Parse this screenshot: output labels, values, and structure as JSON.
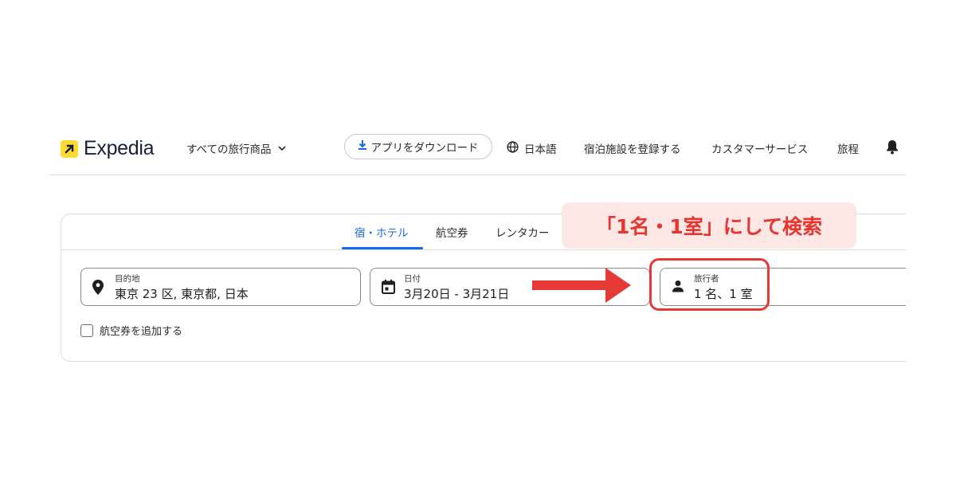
{
  "header": {
    "logo_text": "Expedia",
    "all_products": "すべての旅行商品",
    "app_download": "アプリをダウンロード",
    "language": "日本語",
    "list_property": "宿泊施設を登録する",
    "customer_service": "カスタマーサービス",
    "trips": "旅程",
    "icons": [
      "expedia-logo-icon",
      "chevron-down-icon",
      "download-icon",
      "globe-icon",
      "bell-icon"
    ]
  },
  "search": {
    "tabs": [
      {
        "label": "宿・ホテル",
        "active": true
      },
      {
        "label": "航空券",
        "active": false
      },
      {
        "label": "レンタカー",
        "active": false
      }
    ],
    "destination": {
      "label": "目的地",
      "value": "東京 23 区, 東京都, 日本"
    },
    "dates": {
      "label": "日付",
      "value": "3月20日 - 3月21日"
    },
    "travelers": {
      "label": "旅行者",
      "value": "1 名、1 室"
    },
    "add_flight": {
      "label": "航空券を追加する",
      "checked": false
    }
  },
  "annotation": {
    "callout": "「1名・1室」にして検索"
  },
  "colors": {
    "brand_yellow": "#fddb32",
    "brand_navy": "#191e3b",
    "active_tab": "#1668e3",
    "annotation_red": "#e53935",
    "callout_bg": "#fde7e5"
  }
}
